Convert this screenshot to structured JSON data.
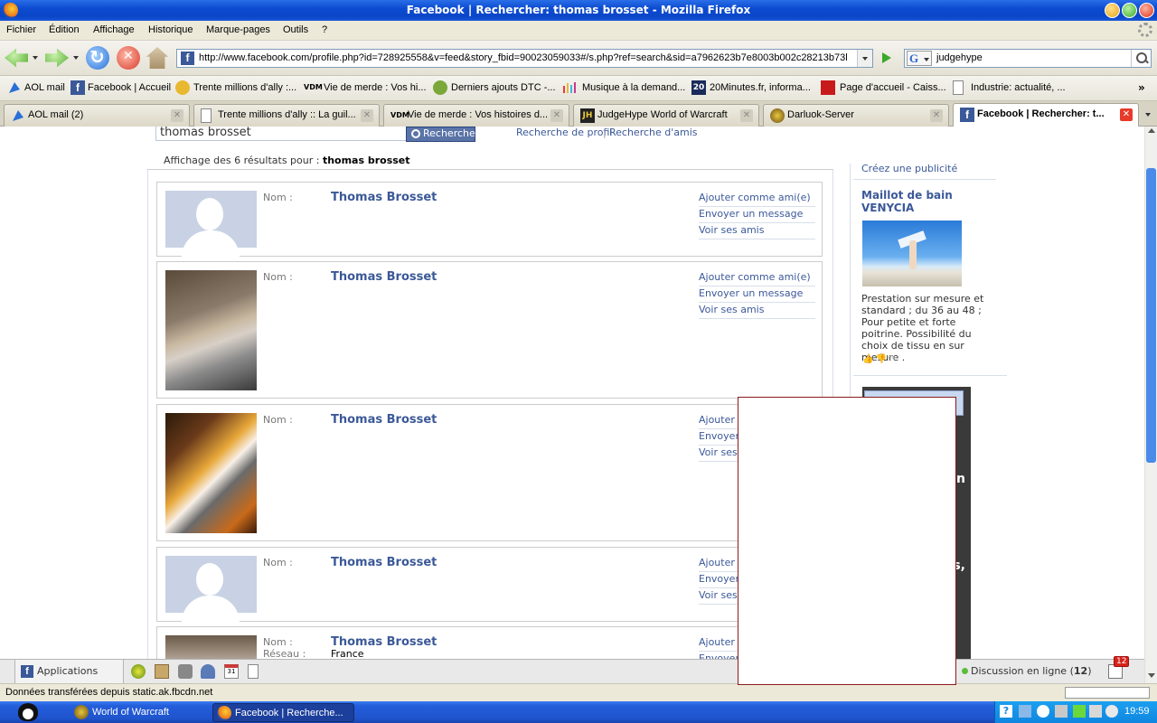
{
  "window": {
    "title": "Facebook | Rechercher: thomas brosset - Mozilla Firefox"
  },
  "menu": [
    "Fichier",
    "Édition",
    "Affichage",
    "Historique",
    "Marque-pages",
    "Outils",
    "?"
  ],
  "nav": {
    "url": "http://www.facebook.com/profile.php?id=728925558&v=feed&story_fbid=90023059033#/s.php?ref=search&sid=a7962623b7e8003b002c28213b73l",
    "search_engine_letter": "G",
    "search_query": "judgehype"
  },
  "bookmarks": [
    {
      "label": "AOL mail",
      "icon": "aol-icon",
      "color": "#2a6fd8"
    },
    {
      "label": "Facebook | Accueil",
      "icon": "facebook-icon",
      "color": "#3b5998"
    },
    {
      "label": "Trente millions d'ally :...",
      "icon": "smiley-icon",
      "color": "#e8b830"
    },
    {
      "label": "Vie de merde : Vos hi...",
      "icon": "vdm-icon",
      "color": "#333333"
    },
    {
      "label": "Derniers ajouts DTC -...",
      "icon": "dtc-icon",
      "color": "#7aa83a"
    },
    {
      "label": "Musique à la demand...",
      "icon": "music-icon",
      "color": "#c83a8a"
    },
    {
      "label": "20Minutes.fr, informa...",
      "icon": "20min-icon",
      "color": "#1a2a5a"
    },
    {
      "label": "Page d'accueil - Caiss...",
      "icon": "caisse-icon",
      "color": "#c81a1a"
    },
    {
      "label": "Industrie: actualité, ...",
      "icon": "page-icon",
      "color": "#ffffff"
    }
  ],
  "bookmarks_more": "»",
  "tabs": [
    {
      "label": "AOL mail (2)",
      "icon": "aol-icon",
      "active": false
    },
    {
      "label": "Trente millions d'ally :: La guil...",
      "icon": "page-icon",
      "active": false
    },
    {
      "label": "Vie de merde : Vos histoires d...",
      "icon": "vdm-icon",
      "active": false
    },
    {
      "label": "JudgeHype World of Warcraft",
      "icon": "judgehype-icon",
      "active": false
    },
    {
      "label": "Darluok-Server",
      "icon": "wow-icon",
      "active": false
    },
    {
      "label": "Facebook | Rechercher: t...",
      "icon": "facebook-icon",
      "active": true
    }
  ],
  "fb": {
    "search_value": "thomas brosset",
    "search_button": "Recherche",
    "profile_search_link": "Recherche de profil",
    "link_separator": "|",
    "friend_search_link": "Recherche d'amis",
    "results_prefix": "Affichage des 6 résultats pour :",
    "results_query": "thomas brosset",
    "name_label": "Nom :",
    "network_label": "Réseau :",
    "results": [
      {
        "name": "Thomas Brosset",
        "photo": "silhouette",
        "actions": [
          "Ajouter comme ami(e)",
          "Envoyer un message",
          "Voir ses amis"
        ]
      },
      {
        "name": "Thomas Brosset",
        "photo": "photo-boy",
        "actions": [
          "Ajouter comme ami(e)",
          "Envoyer un message",
          "Voir ses amis"
        ]
      },
      {
        "name": "Thomas Brosset",
        "photo": "photo-checkered",
        "actions": [
          "Ajouter c",
          "Envoyer",
          "Voir ses a"
        ]
      },
      {
        "name": "Thomas Brosset",
        "photo": "silhouette",
        "actions": [
          "Ajouter c",
          "Envoyer",
          "Voir ses a"
        ]
      },
      {
        "name": "Thomas Brosset",
        "network": "France",
        "photo": "photo-hat",
        "actions": [
          "Ajouter c",
          "Envoyer"
        ]
      }
    ],
    "ad": {
      "create_link": "Créez une publicité",
      "title": "Maillot de bain VENYCIA",
      "body": "Prestation sur mesure et standard ; du 36 au 48 ; Pour petite et forte poitrine. Possibilité du choix de tissu en sur mesure .",
      "ad2_fragment_1": "n",
      "ad2_fragment_2": "s,"
    },
    "bottom_bar": {
      "applications": "Applications",
      "chat_label": "Discussion en ligne",
      "chat_count_open": "(",
      "chat_count": "12",
      "chat_count_close": ")",
      "notif_count": "12"
    }
  },
  "status": {
    "text": "Données transférées depuis static.ak.fbcdn.net"
  },
  "taskbar": {
    "buttons": [
      {
        "label": "World of Warcraft",
        "icon": "wow-icon",
        "active": false
      },
      {
        "label": "Facebook | Recherche...",
        "icon": "firefox-icon",
        "active": true
      }
    ],
    "clock": "19:59"
  }
}
